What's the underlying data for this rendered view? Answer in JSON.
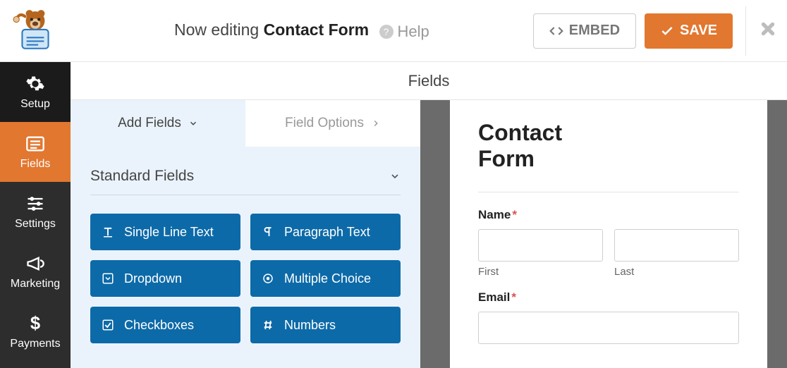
{
  "topbar": {
    "editing_label": "Now editing",
    "form_name": "Contact Form",
    "help_label": "Help",
    "embed_label": "EMBED",
    "save_label": "SAVE"
  },
  "leftnav": {
    "items": [
      {
        "label": "Setup"
      },
      {
        "label": "Fields"
      },
      {
        "label": "Settings"
      },
      {
        "label": "Marketing"
      },
      {
        "label": "Payments"
      }
    ]
  },
  "strip_title": "Fields",
  "panel": {
    "tabs": {
      "add_fields": "Add Fields",
      "field_options": "Field Options"
    },
    "section_title": "Standard Fields",
    "fields": {
      "single_line": "Single Line Text",
      "paragraph": "Paragraph Text",
      "dropdown": "Dropdown",
      "multiple_choice": "Multiple Choice",
      "checkboxes": "Checkboxes",
      "numbers": "Numbers"
    }
  },
  "preview": {
    "title": "Contact Form",
    "name_label": "Name",
    "first_label": "First",
    "last_label": "Last",
    "email_label": "Email"
  }
}
